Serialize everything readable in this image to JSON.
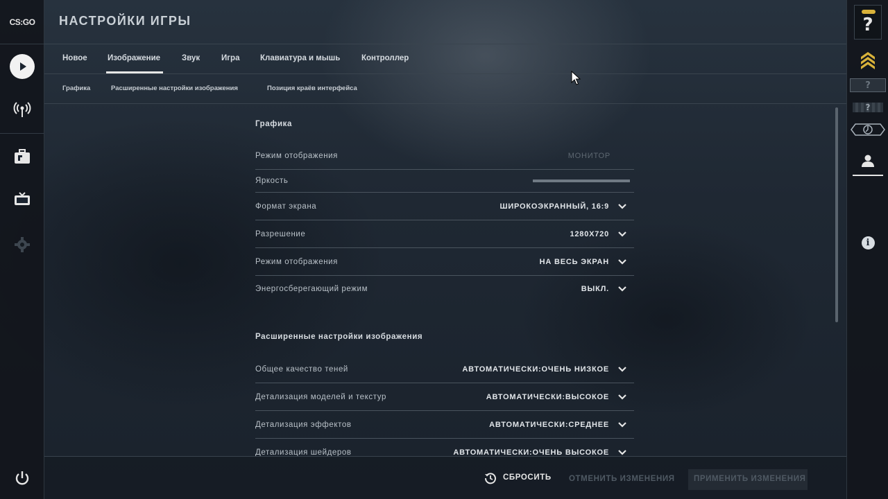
{
  "app": {
    "logo_text": "CS:GO"
  },
  "header": {
    "title": "НАСТРОЙКИ ИГРЫ"
  },
  "tabs": [
    {
      "label": "Новое"
    },
    {
      "label": "Изображение"
    },
    {
      "label": "Звук"
    },
    {
      "label": "Игра"
    },
    {
      "label": "Клавиатура и мышь"
    },
    {
      "label": "Контроллер"
    }
  ],
  "active_tab": "Изображение",
  "subtabs": [
    {
      "label": "Графика"
    },
    {
      "label": "Расширенные настройки изображения"
    },
    {
      "label": "Позиция краёв интерфейса"
    }
  ],
  "sections": {
    "graphics": {
      "title": "Графика",
      "rows": [
        {
          "label": "Режим отображения",
          "value": "МОНИТОР"
        },
        {
          "label": "Яркость",
          "value": ""
        },
        {
          "label": "Формат экрана",
          "value": "ШИРОКОЭКРАННЫЙ, 16:9"
        },
        {
          "label": "Разрешение",
          "value": "1280X720"
        },
        {
          "label": "Режим отображения",
          "value": "НА ВЕСЬ ЭКРАН"
        },
        {
          "label": "Энергосберегающий режим",
          "value": "ВЫКЛ."
        }
      ]
    },
    "advanced": {
      "title": "Расширенные настройки изображения",
      "rows": [
        {
          "label": "Общее качество теней",
          "value": "АВТОМАТИЧЕСКИ:ОЧЕНЬ НИЗКОЕ"
        },
        {
          "label": "Детализация моделей и текстур",
          "value": "АВТОМАТИЧЕСКИ:ВЫСОКОЕ"
        },
        {
          "label": "Детализация эффектов",
          "value": "АВТОМАТИЧЕСКИ:СРЕДНЕЕ"
        },
        {
          "label": "Детализация шейдеров",
          "value": "АВТОМАТИЧЕСКИ:ОЧЕНЬ ВЫСОКОЕ"
        }
      ]
    }
  },
  "footer": {
    "reset_label": "СБРОСИТЬ",
    "cancel_label": "ОТМЕНИТЬ ИЗМЕНЕНИЯ",
    "apply_label": "ПРИМЕНИТЬ ИЗМЕНЕНИЯ"
  },
  "right_rail": {
    "help_glyph": "?",
    "rank_unknown_glyph": "?",
    "info_glyph": "i"
  },
  "colors": {
    "accent": "#e6e6e6",
    "gold": "#d9b23a",
    "disabled": "#5e6872"
  },
  "icons": {
    "left_rail": [
      "play-icon",
      "broadcast-icon",
      "inventory-icon",
      "tv-icon",
      "gear-icon",
      "power-icon"
    ],
    "right_rail": [
      "help-icon",
      "rank-chevrons-icon",
      "unknown-rank-icon",
      "unknown-badge-icon",
      "profile-rank-icon",
      "user-icon",
      "info-icon"
    ]
  }
}
